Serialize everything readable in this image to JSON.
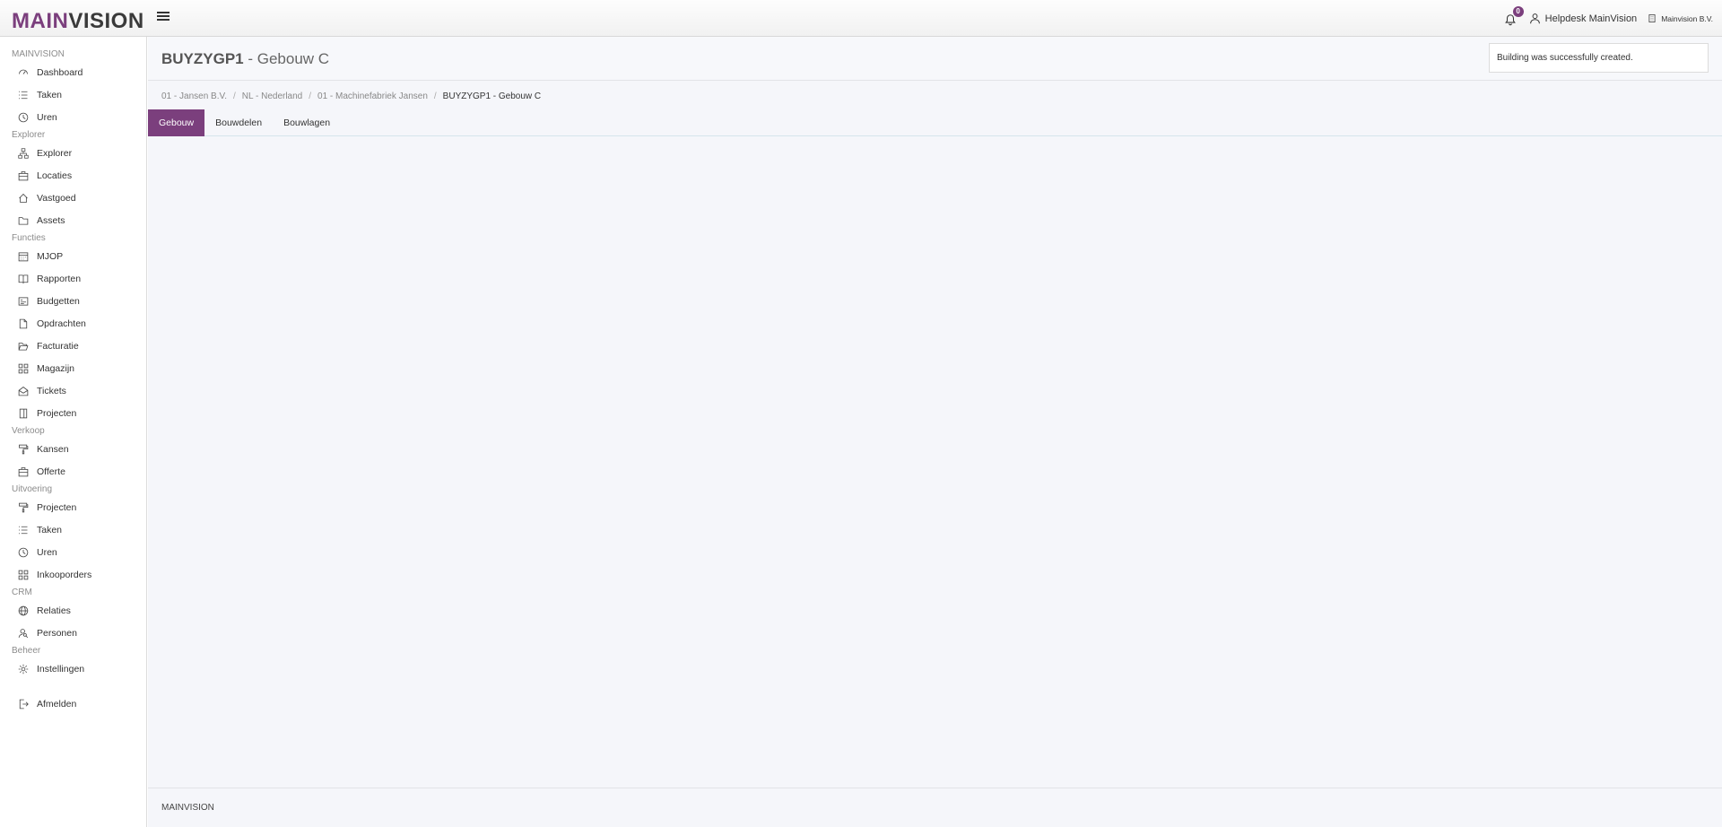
{
  "header": {
    "logo_part1": "MAIN",
    "logo_part2": "VISION",
    "notifications_count": "0",
    "user_name": "Helpdesk MainVision",
    "company_name": "Mainvision B.V."
  },
  "sidebar": {
    "sections": [
      {
        "title": "MAINVISION",
        "items": [
          {
            "label": "Dashboard",
            "icon": "dashboard-icon"
          },
          {
            "label": "Taken",
            "icon": "list-icon"
          },
          {
            "label": "Uren",
            "icon": "clock-icon"
          }
        ]
      },
      {
        "title": "Explorer",
        "items": [
          {
            "label": "Explorer",
            "icon": "sitemap-icon"
          },
          {
            "label": "Locaties",
            "icon": "briefcase-icon"
          },
          {
            "label": "Vastgoed",
            "icon": "home-icon"
          },
          {
            "label": "Assets",
            "icon": "folder-icon"
          }
        ]
      },
      {
        "title": "Functies",
        "items": [
          {
            "label": "MJOP",
            "icon": "calendar-icon"
          },
          {
            "label": "Rapporten",
            "icon": "book-icon"
          },
          {
            "label": "Budgetten",
            "icon": "wallet-icon"
          },
          {
            "label": "Opdrachten",
            "icon": "document-icon"
          },
          {
            "label": "Facturatie",
            "icon": "folder-open-icon"
          },
          {
            "label": "Magazijn",
            "icon": "grid-icon"
          },
          {
            "label": "Tickets",
            "icon": "envelope-open-icon"
          },
          {
            "label": "Projecten",
            "icon": "door-icon"
          }
        ]
      },
      {
        "title": "Verkoop",
        "items": [
          {
            "label": "Kansen",
            "icon": "paint-roller-icon"
          },
          {
            "label": "Offerte",
            "icon": "briefcase-icon"
          }
        ]
      },
      {
        "title": "Uitvoering",
        "items": [
          {
            "label": "Projecten",
            "icon": "paint-roller-icon"
          },
          {
            "label": "Taken",
            "icon": "list-icon"
          },
          {
            "label": "Uren",
            "icon": "clock-icon"
          },
          {
            "label": "Inkooporders",
            "icon": "grid-icon"
          }
        ]
      },
      {
        "title": "CRM",
        "items": [
          {
            "label": "Relaties",
            "icon": "globe-icon"
          },
          {
            "label": "Personen",
            "icon": "user-search-icon"
          }
        ]
      },
      {
        "title": "Beheer",
        "items": [
          {
            "label": "Instellingen",
            "icon": "gear-icon"
          }
        ]
      }
    ],
    "logout_label": "Afmelden"
  },
  "page": {
    "title_code": "BUYZYGP1",
    "title_name": " - Gebouw C",
    "toast": "Building was successfully created.",
    "breadcrumb": [
      "01 - Jansen B.V.",
      "NL - Nederland",
      "01 - Machinefabriek Jansen",
      "BUYZYGP1 - Gebouw C"
    ],
    "tabs": [
      "Gebouw",
      "Bouwdelen",
      "Bouwlagen"
    ],
    "active_tab": "Gebouw"
  },
  "footer": {
    "text": "MAINVISION"
  },
  "colors": {
    "accent": "#7b3f7d",
    "background": "#f5f6fa"
  }
}
